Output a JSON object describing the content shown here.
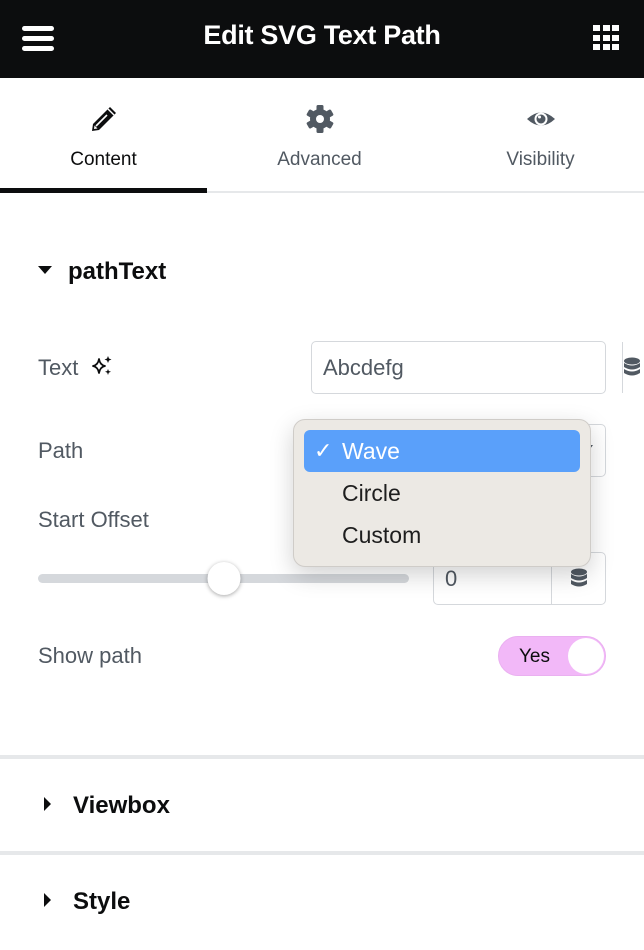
{
  "header": {
    "title": "Edit SVG Text Path",
    "menu_icon": "hamburger-icon",
    "apps_icon": "grid-apps-icon"
  },
  "tabs": [
    {
      "label": "Content",
      "icon": "pencil-icon",
      "active": true
    },
    {
      "label": "Advanced",
      "icon": "gear-icon",
      "active": false
    },
    {
      "label": "Visibility",
      "icon": "eye-icon",
      "active": false
    }
  ],
  "section_pathtext": {
    "title": "pathText",
    "expanded": true,
    "text": {
      "label": "Text",
      "ai_icon": "sparkles-icon",
      "value": "Abcdefg",
      "dynamic_icon": "database-icon"
    },
    "path": {
      "label": "Path",
      "value": "Wave",
      "options": [
        "Wave",
        "Circle",
        "Custom"
      ]
    },
    "start_offset": {
      "label": "Start Offset",
      "value": "0",
      "slider_fraction": 0.5,
      "dynamic_icon": "database-icon"
    },
    "show_path": {
      "label": "Show path",
      "value": "Yes",
      "on": true
    }
  },
  "sections_collapsed": [
    {
      "title": "Viewbox"
    },
    {
      "title": "Style"
    }
  ],
  "colors": {
    "header_bg": "#0c0d0e",
    "toggle_on": "#f2b8f8",
    "dropdown_selected": "#5aa0fa"
  }
}
